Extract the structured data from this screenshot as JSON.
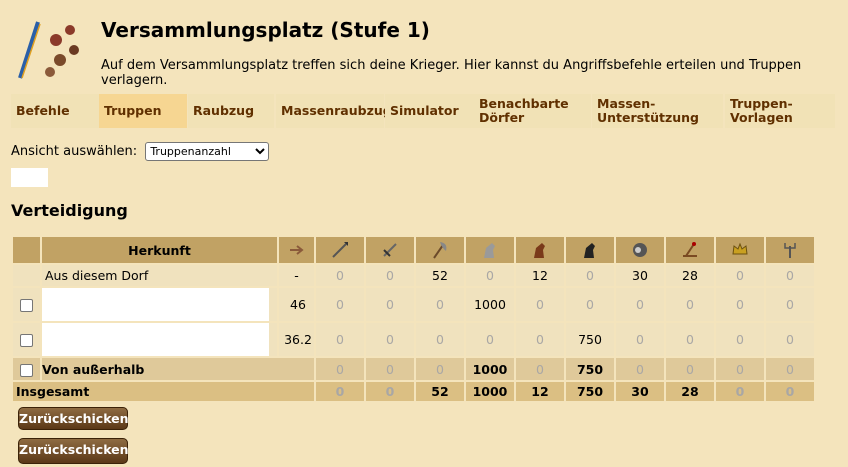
{
  "building": {
    "title": "Versammlungsplatz (Stufe 1)",
    "description": "Auf dem Versammlungsplatz treffen sich deine Krieger. Hier kannst du Angriffsbefehle erteilen und Truppen verlagern."
  },
  "tabs": [
    {
      "label": "Befehle",
      "active": false
    },
    {
      "label": "Truppen",
      "active": true
    },
    {
      "label": "Raubzug",
      "active": false
    },
    {
      "label": "Massenraubzug",
      "active": false
    },
    {
      "label": "Simulator",
      "active": false
    },
    {
      "label": "Benachbarte Dörfer",
      "active": false
    },
    {
      "label": "Massen-Unterstützung",
      "active": false
    },
    {
      "label": "Truppen-Vorlagen",
      "active": false
    }
  ],
  "tab_lines": {
    "benachbarte": [
      "Benachbarte",
      "Dörfer"
    ],
    "massen": [
      "Massen-",
      "Unterstützung"
    ],
    "vorlagen": [
      "Truppen-",
      "Vorlagen"
    ]
  },
  "view_select": {
    "label": "Ansicht auswählen:",
    "selected": "Truppenanzahl"
  },
  "section_title": "Verteidigung",
  "table": {
    "origin_header": "Herkunft",
    "unit_icons": [
      "spear-icon",
      "sword-icon",
      "axe-icon",
      "spy-icon",
      "light-cavalry-icon",
      "heavy-cavalry-icon",
      "ram-icon",
      "catapult-icon",
      "paladin-icon",
      "nobleman-icon"
    ],
    "own": {
      "label": "Aus diesem Dorf",
      "distance": "-",
      "values": [
        "0",
        "0",
        "52",
        "0",
        "12",
        "0",
        "30",
        "28",
        "0",
        "0"
      ]
    },
    "supports": [
      {
        "distance": "46",
        "values": [
          "0",
          "0",
          "0",
          "1000",
          "0",
          "0",
          "0",
          "0",
          "0",
          "0"
        ]
      },
      {
        "distance": "36.2",
        "values": [
          "0",
          "0",
          "0",
          "0",
          "0",
          "750",
          "0",
          "0",
          "0",
          "0"
        ]
      }
    ],
    "outside": {
      "label": "Von außerhalb",
      "values": [
        "0",
        "0",
        "0",
        "1000",
        "0",
        "750",
        "0",
        "0",
        "0",
        "0"
      ]
    },
    "total": {
      "label": "Insgesamt",
      "values": [
        "0",
        "0",
        "52",
        "1000",
        "12",
        "750",
        "30",
        "28",
        "0",
        "0"
      ]
    }
  },
  "buttons": {
    "send_back": "Zurückschicken",
    "send_back_2": "Zurückschicken"
  },
  "colors": {
    "background": "#f4e4bc",
    "tab": "#f1e2b6",
    "tab_active": "#f6d692",
    "header": "#c1a264",
    "total": "#dbbf83",
    "button": "#5b3817"
  }
}
